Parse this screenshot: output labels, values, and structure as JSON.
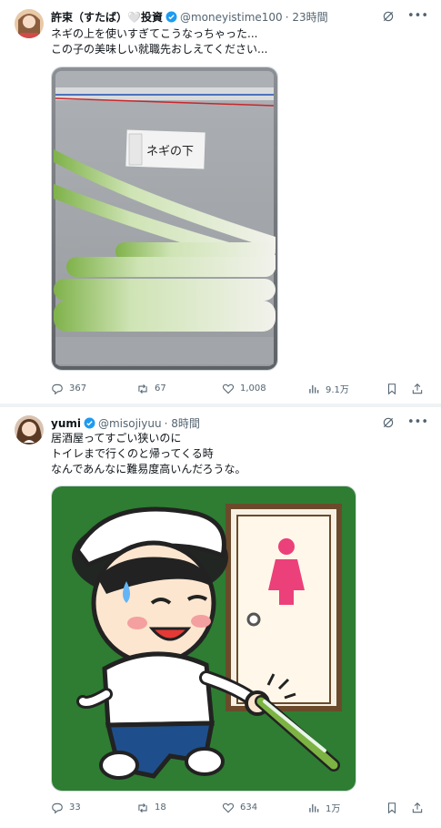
{
  "tweets": [
    {
      "name": "許束（すたば）🤍投資",
      "handle": "@moneyistime100",
      "time": "· 23時間",
      "text": "ネギの上を使いすぎてこうなっちゃった...\nこの子の美味しい就職先おしえてください...",
      "image_label": "ネギの下",
      "replies": "367",
      "retweets": "67",
      "likes": "1,008",
      "views": "9.1万"
    },
    {
      "name": "yumi",
      "handle": "@misojiyuu",
      "time": "· 8時間",
      "text": "居酒屋ってすごい狭いのに\nトイレまで行くのと帰ってくる時\nなんであんなに難易度高いんだろうな。",
      "replies": "33",
      "retweets": "18",
      "likes": "634",
      "views": "1万"
    }
  ],
  "colors": {
    "verified": "#1d9bf0",
    "muted": "#536471",
    "illustration_bg": "#2e7d32",
    "toilet_sign": "#ec407a"
  }
}
